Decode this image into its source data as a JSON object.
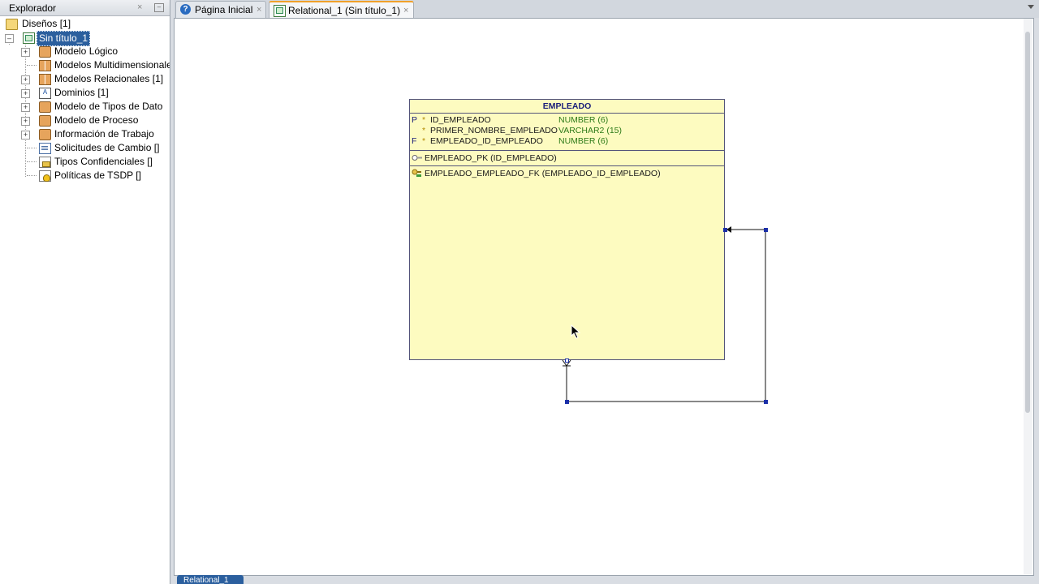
{
  "explorer": {
    "title": "Explorador",
    "close_label": "×",
    "minimize_label": "–",
    "tree": [
      {
        "label": "Diseños [1]",
        "icon": "folder-icon"
      },
      {
        "label": "Sin título_1",
        "icon": "design-icon",
        "selected": true
      },
      {
        "label": "Modelo Lógico",
        "icon": "logical-model-icon"
      },
      {
        "label": "Modelos Multidimensionales",
        "icon": "multidimensional-icon"
      },
      {
        "label": "Modelos Relacionales [1]",
        "icon": "relational-models-icon"
      },
      {
        "label": "Dominios [1]",
        "icon": "domains-icon"
      },
      {
        "label": "Modelo de Tipos de Dato",
        "icon": "datatypes-model-icon"
      },
      {
        "label": "Modelo de Proceso",
        "icon": "process-model-icon"
      },
      {
        "label": "Información de Trabajo",
        "icon": "business-info-icon"
      },
      {
        "label": "Solicitudes de Cambio []",
        "icon": "change-requests-icon"
      },
      {
        "label": "Tipos Confidenciales []",
        "icon": "sensitive-types-icon"
      },
      {
        "label": "Políticas de TSDP []",
        "icon": "tsdp-policies-icon"
      }
    ]
  },
  "tabs": [
    {
      "label": "Página Inicial",
      "icon": "help-icon",
      "close": "×"
    },
    {
      "label": "Relational_1 (Sin título_1)",
      "icon": "relational-diagram-icon",
      "close": "×",
      "active": true
    }
  ],
  "table": {
    "name": "EMPLEADO",
    "columns": [
      {
        "key": "P",
        "required": "*",
        "name": "ID_EMPLEADO",
        "type": "NUMBER (6)"
      },
      {
        "key": "",
        "required": "*",
        "name": "PRIMER_NOMBRE_EMPLEADO",
        "type": "VARCHAR2 (15)"
      },
      {
        "key": "F",
        "required": "*",
        "name": "EMPLEADO_ID_EMPLEADO",
        "type": "NUMBER (6)"
      }
    ],
    "primary_key": "EMPLEADO_PK (ID_EMPLEADO)",
    "foreign_key": "EMPLEADO_EMPLEADO_FK (EMPLEADO_ID_EMPLEADO)"
  },
  "bottom_tab": {
    "label": "Relational_1"
  },
  "colors": {
    "table_fill": "#fdfbc0",
    "table_border": "#53547a",
    "selection": "#2b5f9e",
    "active_tab_accent": "#f0a02a",
    "handle": "#1b2fa8"
  }
}
